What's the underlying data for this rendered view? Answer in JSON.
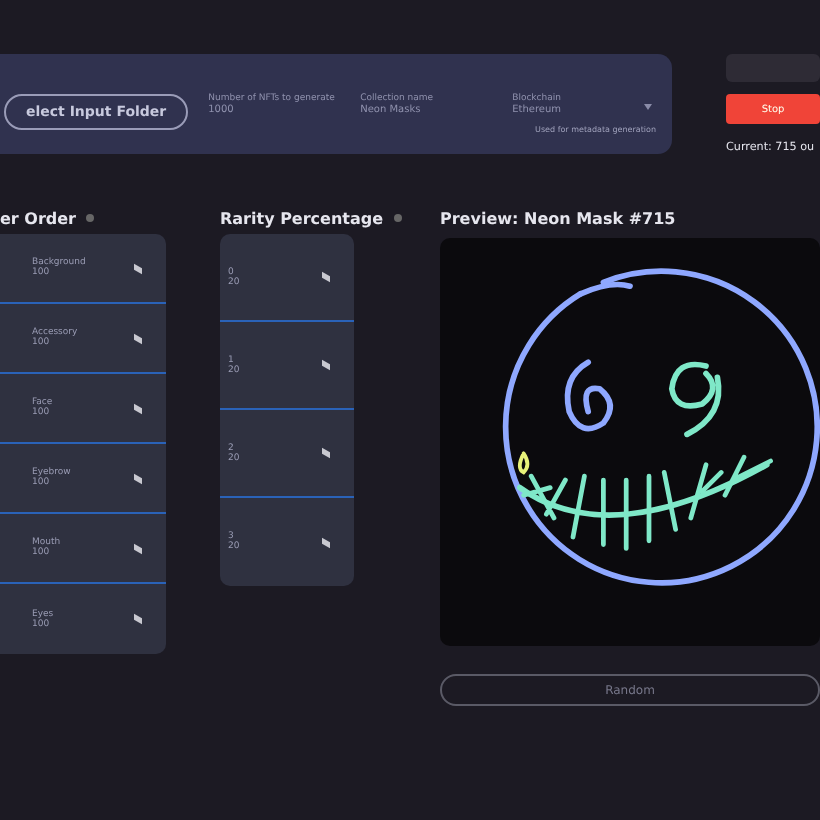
{
  "settings": {
    "folder_button": "elect Input Folder",
    "fields": [
      {
        "label": "Number of NFTs to generate",
        "value": "1000"
      },
      {
        "label": "Collection name",
        "value": "Neon Masks"
      },
      {
        "label": "Blockchain",
        "value": "Ethereum",
        "kind": "select"
      }
    ],
    "note": "Used for metadata generation"
  },
  "controls": {
    "stop_button": "Stop",
    "status": "Current: 715 ou"
  },
  "layer_order": {
    "title": "er Order",
    "items": [
      {
        "name": "Background",
        "value": "100"
      },
      {
        "name": "Accessory",
        "value": "100"
      },
      {
        "name": "Face",
        "value": "100"
      },
      {
        "name": "Eyebrow",
        "value": "100"
      },
      {
        "name": "Mouth",
        "value": "100"
      },
      {
        "name": "Eyes",
        "value": "100"
      }
    ]
  },
  "rarity": {
    "title": "Rarity Percentage",
    "items": [
      {
        "name": "0",
        "value": "20"
      },
      {
        "name": "1",
        "value": "20"
      },
      {
        "name": "2",
        "value": "20"
      },
      {
        "name": "3",
        "value": "20"
      }
    ]
  },
  "preview": {
    "title": "Preview: Neon Mask #715",
    "random_button": "Random"
  }
}
